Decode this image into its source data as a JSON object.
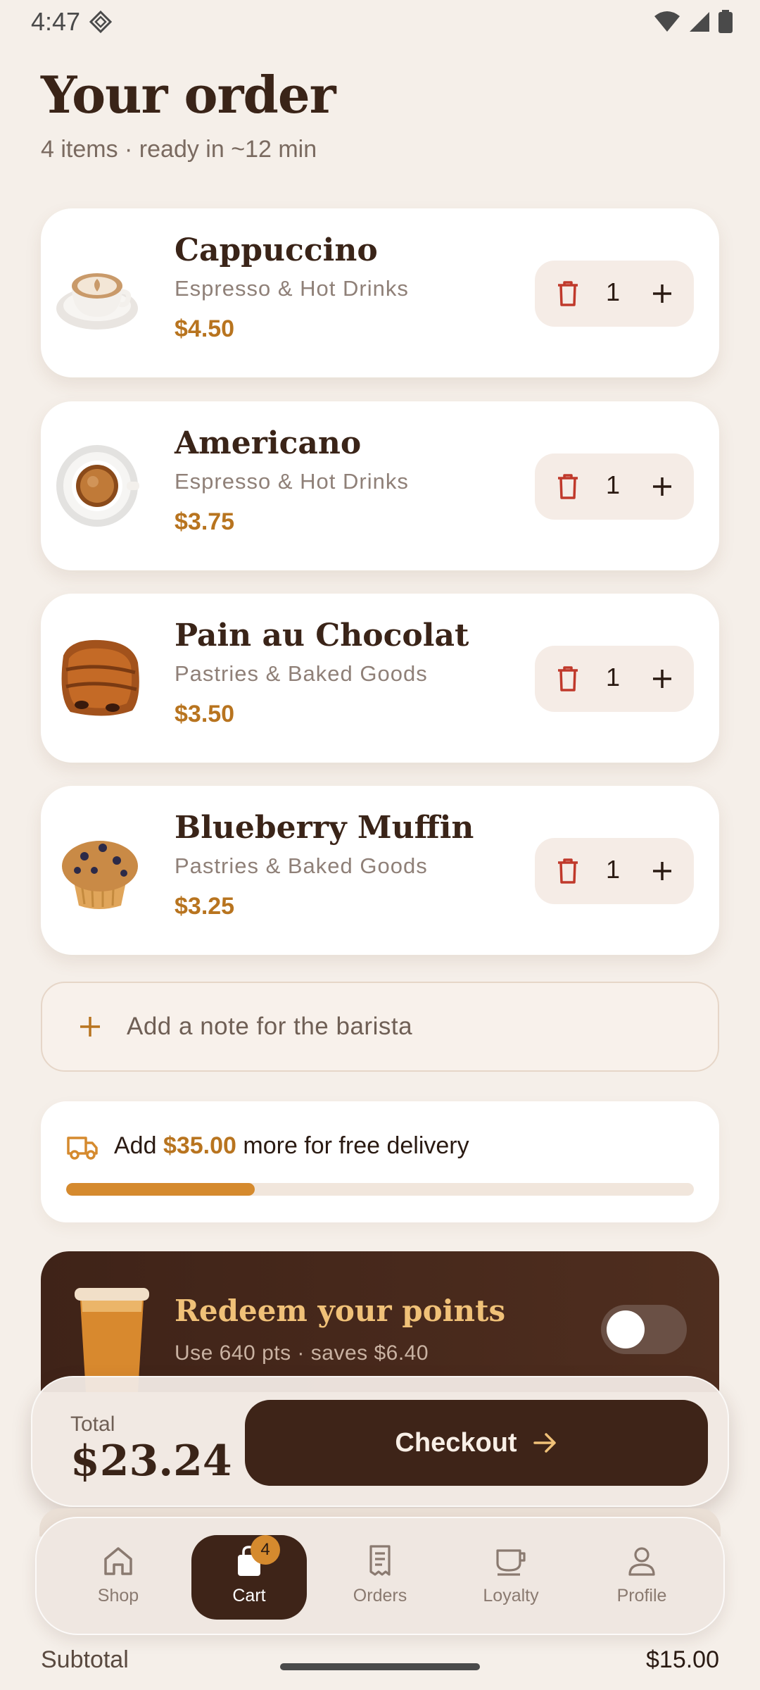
{
  "status_bar": {
    "time": "4:47"
  },
  "header": {
    "title": "Your order",
    "subtitle": "4 items · ready in ~12 min"
  },
  "items": [
    {
      "name": "Cappuccino",
      "category": "Espresso & Hot Drinks",
      "price": "$4.50",
      "quantity": "1"
    },
    {
      "name": "Americano",
      "category": "Espresso & Hot Drinks",
      "price": "$3.75",
      "quantity": "1"
    },
    {
      "name": "Pain au Chocolat",
      "category": "Pastries & Baked Goods",
      "price": "$3.50",
      "quantity": "1"
    },
    {
      "name": "Blueberry Muffin",
      "category": "Pastries & Baked Goods",
      "price": "$3.25",
      "quantity": "1"
    }
  ],
  "note": {
    "label": "Add a note for the barista"
  },
  "delivery": {
    "prefix": "Add ",
    "amount": "$35.00",
    "suffix": " more for free delivery",
    "progress": 0.3
  },
  "redeem": {
    "title": "Redeem your points",
    "subtitle": "Use 640 pts · saves $6.40",
    "enabled": false
  },
  "checkout": {
    "total_label": "Total",
    "total_value": "$23.24",
    "button_label": "Checkout"
  },
  "nav": {
    "items": [
      {
        "label": "Shop",
        "icon": "home-icon"
      },
      {
        "label": "Cart",
        "icon": "shopping-bag-icon",
        "badge": "4",
        "active": true
      },
      {
        "label": "Orders",
        "icon": "receipt-icon"
      },
      {
        "label": "Loyalty",
        "icon": "coffee-cup-icon"
      },
      {
        "label": "Profile",
        "icon": "person-icon"
      }
    ]
  },
  "subtotal": {
    "label": "Subtotal",
    "value": "$15.00"
  },
  "colors": {
    "background": "#f5efe9",
    "accent": "#b8741f",
    "brand_dark": "#3e2418",
    "delete": "#c0392b",
    "progress": "#d58a2e"
  }
}
